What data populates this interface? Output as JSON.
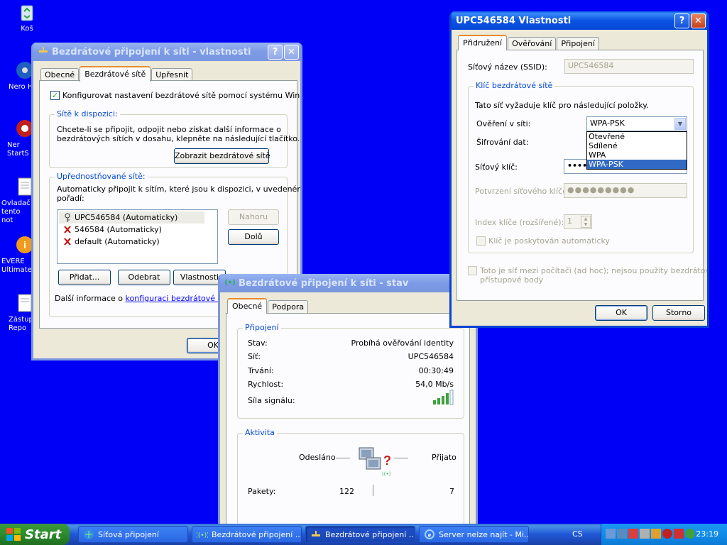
{
  "desktop": {
    "icons": [
      {
        "name": "recycle-bin",
        "label": "Koš"
      },
      {
        "name": "nero",
        "label": "Nero H"
      },
      {
        "name": "nero-startsmart",
        "label": "Ner StartSm"
      },
      {
        "name": "control-panel",
        "label": "Ovladač tento not"
      },
      {
        "name": "everest",
        "label": "EVERE Ultimate"
      },
      {
        "name": "placeholder-report",
        "label": "Zástup Repo"
      }
    ]
  },
  "props_window": {
    "title": "Bezdrátové připojení k síti - vlastnosti",
    "tabs": [
      "Obecné",
      "Bezdrátové sítě",
      "Upřesnit"
    ],
    "configure_checkbox": "Konfigurovat nastavení bezdrátové sítě pomocí systému Windows",
    "available_title": "Sítě k dispozici:",
    "available_text_1": "Chcete-li se připojit, odpojit nebo získat další informace o",
    "available_text_2": "bezdrátových sítích v dosahu, klepněte na následující tlačítko.",
    "show_button": "Zobrazit bezdrátové sítě",
    "preferred_title": "Upřednostňované sítě:",
    "preferred_text_1": "Automaticky připojit k sítím, které jsou k dispozici, v uvedeném",
    "preferred_text_2": "pořadí:",
    "networks": [
      "UPC546584 (Automaticky)",
      "546584 (Automaticky)",
      "default (Automaticky)"
    ],
    "up_button": "Nahoru",
    "down_button": "Dolů",
    "add_button": "Přidat...",
    "remove_button": "Odebrat",
    "properties_button": "Vlastnosti",
    "more_info_prefix": "Další informace o ",
    "more_info_link": "konfiguraci bezdrátové sítě",
    "ok_button": "OK"
  },
  "status_window": {
    "title": "Bezdrátové připojení k síti - stav",
    "tabs": [
      "Obecné",
      "Podpora"
    ],
    "connection_title": "Připojení",
    "rows": [
      {
        "label": "Stav:",
        "value": "Probíhá ověřování identity"
      },
      {
        "label": "Síť:",
        "value": "UPC546584"
      },
      {
        "label": "Trvání:",
        "value": "00:30:49"
      },
      {
        "label": "Rychlost:",
        "value": "54,0 Mb/s"
      }
    ],
    "signal_label": "Síla signálu:",
    "activity_title": "Aktivita",
    "sent_label": "Odesláno",
    "received_label": "Přijato",
    "packets_label": "Pakety:",
    "packets_sent": "122",
    "packets_received": "7"
  },
  "upc_window": {
    "title": "UPC546584 Vlastnosti",
    "tabs": [
      "Přidružení",
      "Ověřování",
      "Připojení"
    ],
    "ssid_label": "Síťový název (SSID):",
    "ssid_value": "UPC546584",
    "key_group_title": "Klíč bezdrátové sítě",
    "key_intro": "Tato síť vyžaduje klíč pro následující položky.",
    "auth_label": "Ověření v síti:",
    "auth_value": "WPA-PSK",
    "auth_options": [
      "Otevřené",
      "Sdílené",
      "WPA",
      "WPA-PSK"
    ],
    "encryption_label": "Šifrování dat:",
    "key_label": "Síťový klíč:",
    "key_value": "••••",
    "confirm_label": "Potvrzení síťového klíče:",
    "confirm_value": "●●●●●●●●●",
    "index_label": "Index klíče (rozšířené):",
    "index_value": "1",
    "auto_key_label": "Klíč je poskytován automaticky",
    "adhoc_line1": "Toto je síť mezi počítači (ad hoc); nejsou použity bezdrátové",
    "adhoc_line2": "přístupové body",
    "ok_button": "OK",
    "cancel_button": "Storno"
  },
  "taskbar": {
    "start_label": "Start",
    "tasks": [
      "Síťová připojení",
      "Bezdrátové připojení ...",
      "Bezdrátové připojení ...",
      "Server nelze najít - Mi..."
    ],
    "language": "CS",
    "clock": "23:19"
  },
  "colors": {
    "desktop": "#0000f6",
    "title_active": "#0a54e3",
    "accent_orange": "#e68b2c",
    "selection": "#316ac5"
  }
}
